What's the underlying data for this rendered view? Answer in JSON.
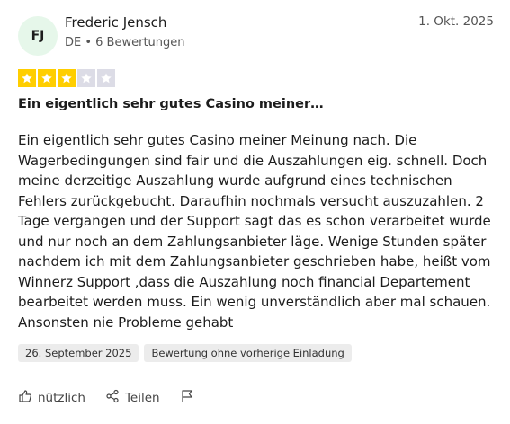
{
  "reviewer": {
    "initials": "FJ",
    "name": "Frederic Jensch",
    "meta": "DE • 6 Bewertungen"
  },
  "review": {
    "date": "1. Okt. 2025",
    "rating": 3,
    "max_rating": 5,
    "title": "Ein eigentlich sehr gutes Casino meiner…",
    "body": "Ein eigentlich sehr gutes Casino meiner Meinung nach. Die Wagerbedingungen sind fair und die Auszahlungen eig. schnell. Doch meine derzeitige Auszahlung wurde aufgrund eines technischen Fehlers zurückgebucht. Darauf­hin nochmals versucht auszuzahlen. 2 Tage vergangen und der Support sagt das es schon verarbeitet wurde und nur noch an dem Zahlungsanbieter läge. Wenige Stunden später nachdem ich mit dem Zahlungsanbieter geschrieben habe, heißt vom Winnerz Support ,dass die Auszahlung noch financial Departement bearbeitet werden muss. Ein wenig unverständlich aber mal schauen. Ansonsten nie Probleme gehabt",
    "tags": [
      "26. September 2025",
      "Bewertung ohne vorherige Einladung"
    ]
  },
  "actions": {
    "helpful_label": "nützlich",
    "share_label": "Teilen"
  },
  "colors": {
    "star_filled": "#ffce00",
    "star_empty": "#dcdce6",
    "avatar_bg": "#e6f7ea"
  },
  "icons": [
    "thumbs-up-icon",
    "share-icon",
    "flag-icon",
    "star-icon"
  ]
}
